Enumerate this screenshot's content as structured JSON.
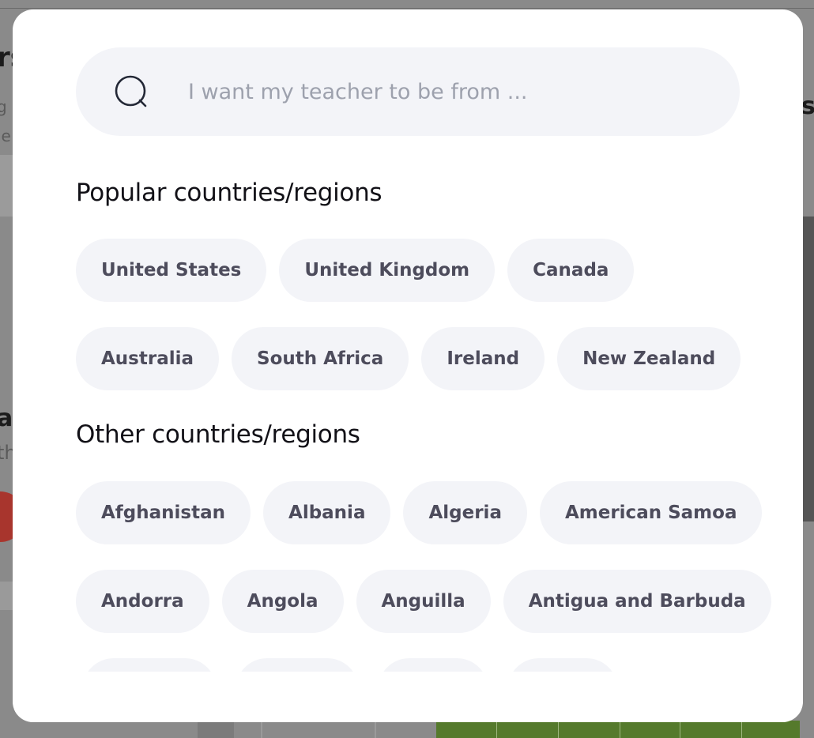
{
  "search": {
    "placeholder": "I want my teacher to be from ..."
  },
  "popular": {
    "title": "Popular countries/regions",
    "rows": [
      [
        "United States",
        "United Kingdom",
        "Canada"
      ],
      [
        "Australia",
        "South Africa",
        "Ireland",
        "New Zealand"
      ]
    ]
  },
  "other": {
    "title": "Other countries/regions",
    "rows": [
      [
        "Afghanistan",
        "Albania",
        "Algeria",
        "American Samoa"
      ],
      [
        "Andorra",
        "Angola",
        "Anguilla",
        "Antigua and Barbuda"
      ]
    ]
  },
  "colors": {
    "chip_bg": "#f3f4f8",
    "chip_text": "#4d4c5c",
    "title_text": "#121117",
    "placeholder": "#9da1ad",
    "overlay": "#8a8a8a"
  },
  "icons": {
    "search": "search-icon"
  }
}
